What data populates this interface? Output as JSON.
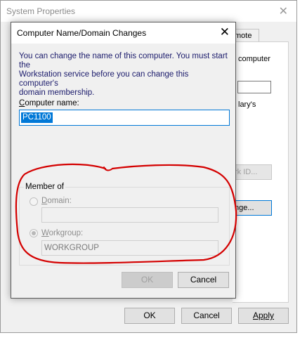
{
  "system_properties": {
    "title": "System Properties",
    "close_glyph": "✕",
    "tab_remote": "mote",
    "text_computer": "computer",
    "text_brary": "lary's",
    "network_id_button": "rk ID...",
    "change_button": "nge...",
    "ok_button": "OK",
    "cancel_button": "Cancel",
    "apply_button": "Apply"
  },
  "dialog": {
    "title": "Computer Name/Domain Changes",
    "close_glyph": "✕",
    "description_line1": "You can change the name of this computer.  You must start the",
    "description_line2": "Workstation service before you can change this computer's",
    "description_line3": "domain membership.",
    "computer_name_label_prefix": "C",
    "computer_name_label_rest": "omputer name:",
    "computer_name_value": "PC1100",
    "member_of_label": "Member of",
    "domain_label_prefix": "D",
    "domain_label_rest": "omain:",
    "domain_value": "",
    "workgroup_label_prefix": "W",
    "workgroup_label_rest": "orkgroup:",
    "workgroup_value": "WORKGROUP",
    "ok_button": "OK",
    "cancel_button": "Cancel"
  },
  "colors": {
    "annotation": "#d40000",
    "selection": "#0078d7"
  }
}
